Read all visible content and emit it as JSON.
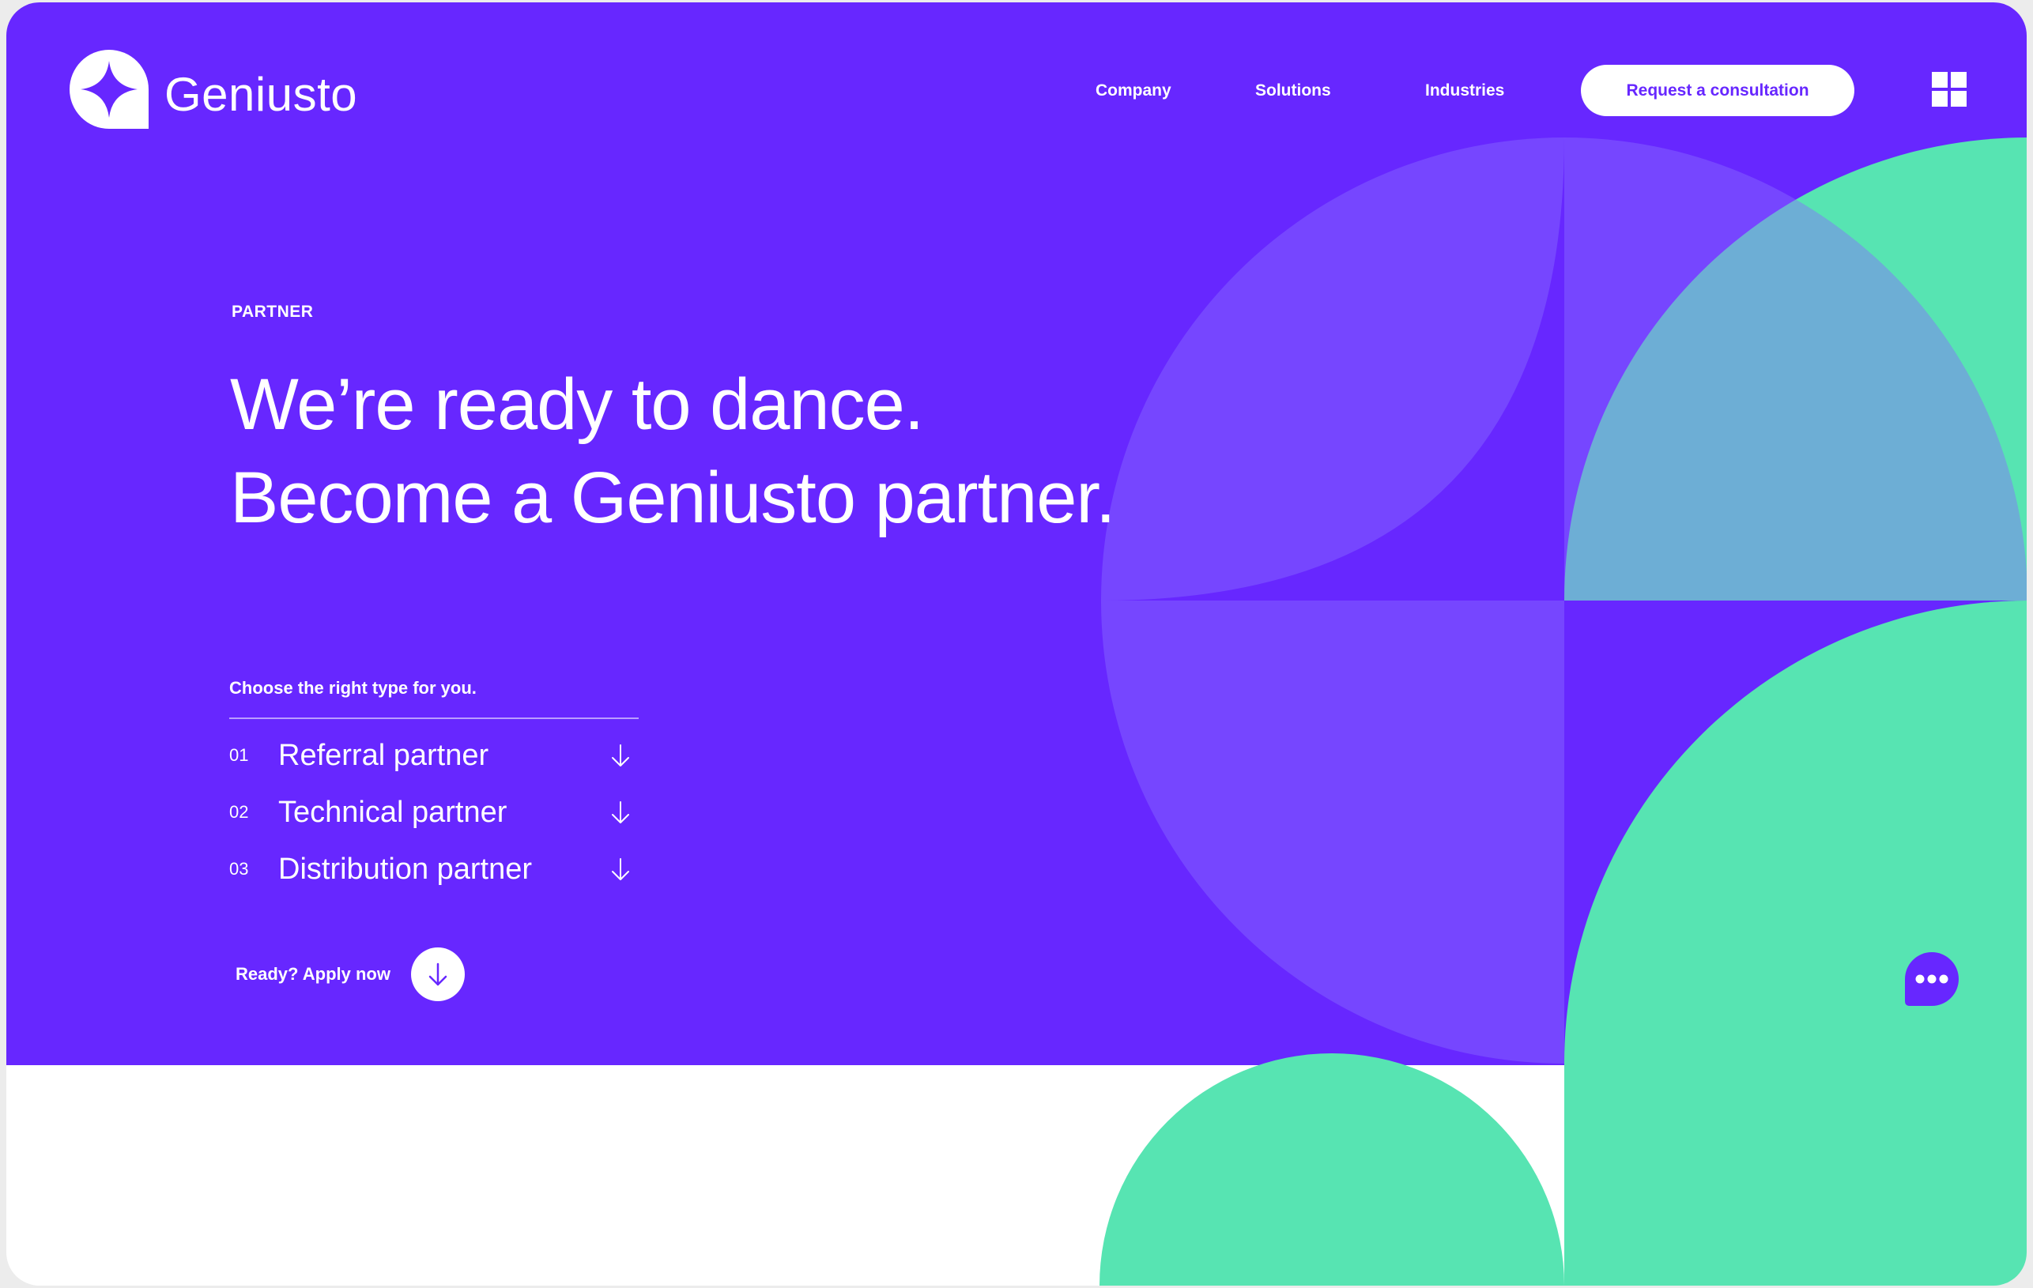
{
  "brand": {
    "name": "Geniusto",
    "logo_icon": "four-point-star-icon"
  },
  "nav": {
    "items": [
      {
        "label": "Company"
      },
      {
        "label": "Solutions"
      },
      {
        "label": "Industries"
      }
    ],
    "cta_label": "Request a consultation",
    "menu_icon": "grid-menu-icon"
  },
  "hero": {
    "eyebrow": "PARTNER",
    "headline_line1": "We’re ready to dance.",
    "headline_line2": "Become a Geniusto partner."
  },
  "chooser": {
    "label": "Choose the right type for you.",
    "options": [
      {
        "num": "01",
        "label": "Referral partner",
        "icon": "arrow-down-icon"
      },
      {
        "num": "02",
        "label": "Technical partner",
        "icon": "arrow-down-icon"
      },
      {
        "num": "03",
        "label": "Distribution partner",
        "icon": "arrow-down-icon"
      }
    ]
  },
  "apply": {
    "label": "Ready? Apply now",
    "icon": "arrow-down-circle-icon"
  },
  "chat": {
    "icon": "chat-bubble-icon"
  },
  "colors": {
    "primary": "#6727ff",
    "accent": "#57e4b2",
    "overlay": "#7a50f5",
    "white": "#ffffff"
  }
}
